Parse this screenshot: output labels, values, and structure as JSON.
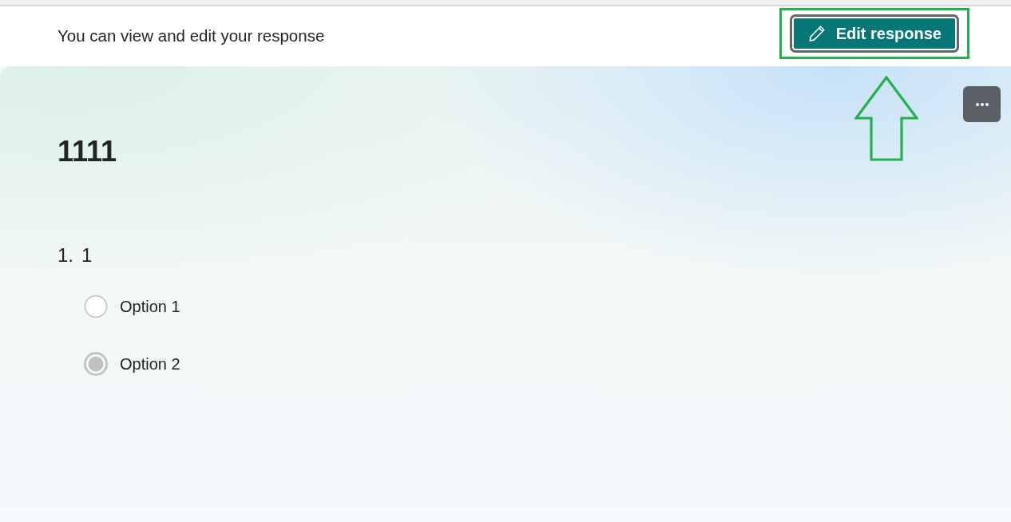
{
  "header": {
    "message": "You can view and edit your response",
    "edit_button": {
      "label": "Edit response",
      "focused": true,
      "highlighted": true
    }
  },
  "form": {
    "title": "1111",
    "questions": [
      {
        "number": "1.",
        "text": "1",
        "disabled": true,
        "options": [
          {
            "label": "Option 1",
            "selected": false
          },
          {
            "label": "Option 2",
            "selected": true
          }
        ]
      }
    ]
  }
}
